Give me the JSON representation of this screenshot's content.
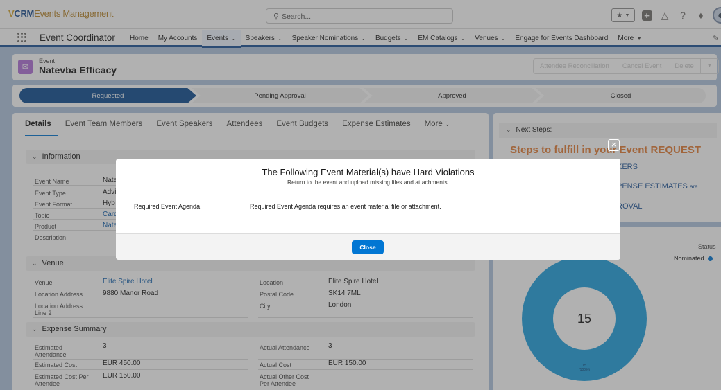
{
  "header": {
    "logo_prefix": "CRM",
    "logo_suffix": "Events Management",
    "search_placeholder": "Search...",
    "app_name": "Event Coordinator"
  },
  "nav": {
    "items": [
      {
        "label": "Home",
        "dropdown": false
      },
      {
        "label": "My Accounts",
        "dropdown": false
      },
      {
        "label": "Events",
        "dropdown": true,
        "active": true
      },
      {
        "label": "Speakers",
        "dropdown": true
      },
      {
        "label": "Speaker Nominations",
        "dropdown": true
      },
      {
        "label": "Budgets",
        "dropdown": true
      },
      {
        "label": "EM Catalogs",
        "dropdown": true
      },
      {
        "label": "Venues",
        "dropdown": true
      },
      {
        "label": "Engage for Events Dashboard",
        "dropdown": false
      },
      {
        "label": "More",
        "dropdown": true
      }
    ]
  },
  "record": {
    "object_label": "Event",
    "name": "Natevba Efficacy",
    "actions": [
      "Attendee Reconciliation",
      "Cancel Event",
      "Delete"
    ]
  },
  "path": {
    "stages": [
      "Requested",
      "Pending Approval",
      "Approved",
      "Closed"
    ],
    "current": "Requested"
  },
  "tabs": [
    "Details",
    "Event Team Members",
    "Event Speakers",
    "Attendees",
    "Event Budgets",
    "Expense Estimates",
    "More"
  ],
  "sections": {
    "information": "Information",
    "venue": "Venue",
    "expense": "Expense Summary"
  },
  "information": {
    "labels": [
      "Event Name",
      "Event Type",
      "Event Format",
      "Topic",
      "Product",
      "Description"
    ],
    "values": [
      "Nate",
      "Advi",
      "Hyb",
      "Card",
      "Nate",
      ""
    ]
  },
  "venue": {
    "venue_label": "Venue",
    "venue_value": "Elite Spire Hotel",
    "addr_label": "Location Address",
    "addr_value": "9880 Manor Road",
    "addr2_label": "Location Address Line 2",
    "addr2_value": "",
    "location_label": "Location",
    "location_value": "Elite Spire Hotel",
    "postal_label": "Postal Code",
    "postal_value": "SK14 7ML",
    "city_label": "City",
    "city_value": "London"
  },
  "expense": {
    "est_att_label": "Estimated Attendance",
    "est_att_value": "3",
    "act_att_label": "Actual Attendance",
    "act_att_value": "3",
    "est_cost_label": "Estimated Cost",
    "est_cost_value": "EUR 450.00",
    "act_cost_label": "Actual Cost",
    "act_cost_value": "EUR 150.00",
    "est_cpa_label": "Estimated Cost Per Attendee",
    "est_cpa_value": "EUR 150.00",
    "act_other_label": "Actual Other Cost Per Attendee",
    "act_other_value": ""
  },
  "side": {
    "next_steps": "Next Steps:",
    "steps_title": "Steps to fulfill in your Event REQUEST",
    "line1": "KERS",
    "line2": "PENSE ESTIMATES",
    "line2_suffix": "are",
    "line3": "ROVAL",
    "status_label": "Status",
    "legend_label": "Nominated",
    "donut_total": "15",
    "slice_label_value": "15",
    "slice_label_pct": "(100%)"
  },
  "chart_data": {
    "type": "pie",
    "categories": [
      "Nominated"
    ],
    "values": [
      15
    ],
    "total": 15
  },
  "modal": {
    "title": "The Following Event Material(s) have Hard Violations",
    "subtitle": "Return to the event and upload missing files and attachments.",
    "violation_name": "Required Event Agenda",
    "violation_message": "Required Event Agenda requires an event material file or attachment.",
    "close_label": "Close"
  },
  "colors": {
    "brand": "#1b5297",
    "accent": "#0176d3",
    "path_active": "#0f4d92",
    "steps_title": "#e37c35",
    "donut": "#1fa0de"
  }
}
